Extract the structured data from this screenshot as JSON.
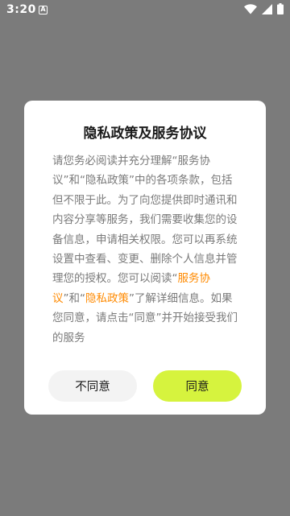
{
  "status_bar": {
    "time": "3:20",
    "notification_glyph": "A",
    "icons": [
      "wifi-icon",
      "signal-icon",
      "battery-icon"
    ]
  },
  "dialog": {
    "title": "隐私政策及服务协议",
    "body": {
      "part1": "请您务必阅读并充分理解“服务协议”和“隐私政策”中的各项条款，包括但不限于此。为了向您提供即时通讯和内容分享等服务，我们需要收集您的设备信息，申请相关权限。您可以再系统设置中查看、变更、删除个人信息并管理您的授权。您可以阅读“",
      "link_service": "服务协议",
      "part2": "”和“",
      "link_privacy": "隐私政策",
      "part3": "”了解详细信息。如果您同意，请点击“同意”并开始接受我们的服务"
    },
    "disagree_label": "不同意",
    "agree_label": "同意"
  },
  "colors": {
    "overlay": "#7b7b7b",
    "link": "#ff8a00",
    "agree_button": "#d6f33e",
    "disagree_button": "#f3f3f3"
  }
}
